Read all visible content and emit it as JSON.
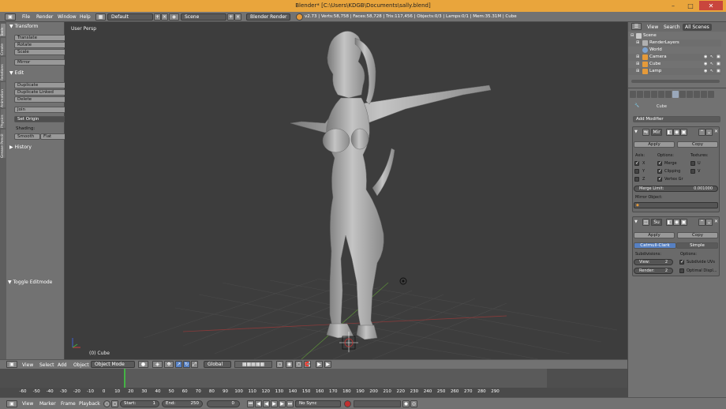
{
  "window": {
    "title": "Blender* [C:\\Users\\KDGB\\Documents\\sally.blend]"
  },
  "info_header": {
    "menus": [
      "File",
      "Render",
      "Window",
      "Help"
    ],
    "screen_layout": "Default",
    "scene": "Scene",
    "render_engine": "Blender Render",
    "stats": "v2.73 | Verts:58,758 | Faces:58,728 | Tris:117,456 | Objects:0/3 | Lamps:0/1 | Mem:35.31M | Cube"
  },
  "toolshelf": {
    "tabs": [
      "Tools",
      "Create",
      "Relations",
      "Animation",
      "Physics",
      "Grease Pencil"
    ],
    "transform_header": "Transform",
    "transform_buttons": [
      "Translate",
      "Rotate",
      "Scale"
    ],
    "mirror": "Mirror",
    "edit_header": "Edit",
    "edit_buttons": [
      "Duplicate",
      "Duplicate Linked",
      "Delete"
    ],
    "join": "Join",
    "set_origin": "Set Origin",
    "shading_label": "Shading:",
    "smooth": "Smooth",
    "flat": "Flat",
    "history_header": "History",
    "toggle_editmode": "Toggle Editmode"
  },
  "viewport": {
    "view_label": "User Persp",
    "object_label": "(0) Cube"
  },
  "viewport_header": {
    "menus": [
      "View",
      "Select",
      "Add",
      "Object"
    ],
    "mode": "Object Mode",
    "orientation": "Global"
  },
  "timeline": {
    "ticks": [
      -60,
      -50,
      -40,
      -30,
      -20,
      -10,
      0,
      10,
      20,
      30,
      40,
      50,
      60,
      70,
      80,
      90,
      100,
      110,
      120,
      130,
      140,
      150,
      160,
      170,
      180,
      190,
      200,
      210,
      220,
      230,
      240,
      250,
      260,
      270,
      280,
      290
    ]
  },
  "timeline_header": {
    "menus": [
      "View",
      "Marker",
      "Frame",
      "Playback"
    ],
    "start_label": "Start:",
    "start_value": "1",
    "end_label": "End:",
    "end_value": "250",
    "current_frame": "0",
    "sync": "No Sync"
  },
  "outliner": {
    "tabs": [
      "View",
      "Search",
      "All Scenes"
    ],
    "items": [
      {
        "label": "Scene",
        "color": "#c9c9c9"
      },
      {
        "label": "RenderLayers",
        "color": "#b0b0b0"
      },
      {
        "label": "World",
        "color": "#7da2cf"
      },
      {
        "label": "Camera",
        "color": "#e59a3a"
      },
      {
        "label": "Cube",
        "color": "#e59a3a"
      },
      {
        "label": "Lamp",
        "color": "#e59a3a"
      }
    ]
  },
  "properties": {
    "object_name": "Cube",
    "add_modifier": "Add Modifier",
    "mirror_modifier": {
      "name": "Mir",
      "apply": "Apply",
      "copy": "Copy",
      "axis_label": "Axis:",
      "options_label": "Options:",
      "textures_label": "Textures:",
      "axes": [
        "X",
        "Y",
        "Z"
      ],
      "options": [
        "Merge",
        "Clipping",
        "Vertex Gr"
      ],
      "textures": [
        "U",
        "V"
      ],
      "merge_limit_label": "Merge Limit:",
      "merge_limit_value": "0.001000",
      "mirror_object_label": "Mirror Object:"
    },
    "subsurf_modifier": {
      "name": "Su",
      "apply": "Apply",
      "copy": "Copy",
      "catmull": "Catmull-Clark",
      "simple": "Simple",
      "subdivisions_label": "Subdivisions:",
      "options_label": "Options:",
      "view_label": "View:",
      "view_value": "2",
      "render_label": "Render:",
      "render_value": "2",
      "subdivide_uvs": "Subdivide UVs",
      "optimal_display": "Optimal Displ..."
    }
  }
}
